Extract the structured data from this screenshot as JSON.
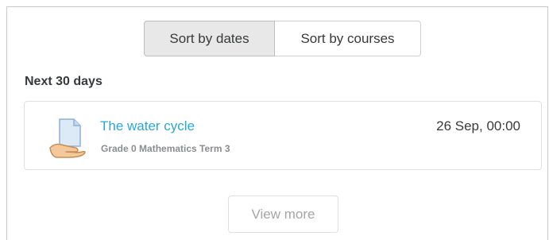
{
  "sort": {
    "by_dates_label": "Sort by dates",
    "by_courses_label": "Sort by courses"
  },
  "section": {
    "heading": "Next 30 days"
  },
  "events": [
    {
      "icon": "assignment-icon",
      "title": "The water cycle",
      "course": "Grade 0 Mathematics Term 3",
      "date": "26 Sep, 00:00"
    }
  ],
  "footer": {
    "view_more_label": "View more"
  },
  "colors": {
    "link": "#29a8d8",
    "active_sort_bg": "#e8e8e8",
    "text": "#373a3c",
    "muted": "#8a8d90"
  }
}
